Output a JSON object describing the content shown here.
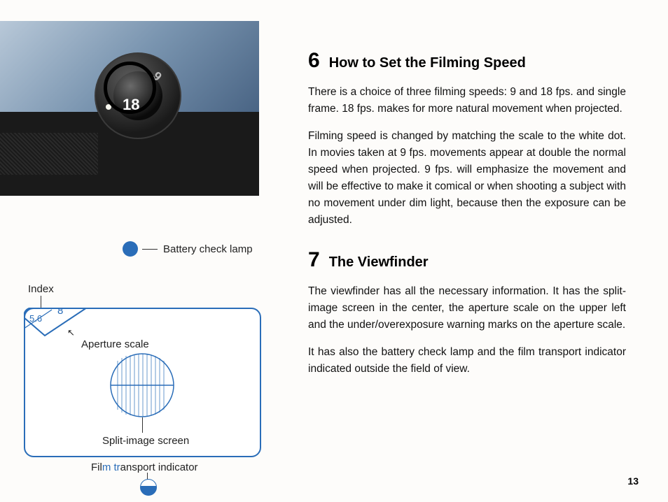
{
  "left": {
    "dial": {
      "num_18": "18",
      "num_9": "9"
    },
    "battery_check_label": "Battery check lamp",
    "index_label": "Index",
    "aperture": {
      "n56": "5.6",
      "n8": "8",
      "label": "Aperture scale"
    },
    "split_label": "Split-image screen",
    "film_label_pre": "Fil",
    "film_label_m": "m tr",
    "film_label_post": "ansport indicator"
  },
  "sections": [
    {
      "num": "6",
      "title": "How to Set the Filming Speed",
      "paras": [
        "There is a choice of three filming speeds: 9 and 18 fps. and single frame. 18 fps. makes for more natural movement when projected.",
        "Filming speed is changed by matching the scale to the white dot. In movies taken at 9 fps. movements appear at double the normal speed when projected. 9 fps. will emphasize the movement and will be effective to make it comical or when shooting a subject with no movement under dim light, because then the exposure can be adjusted."
      ]
    },
    {
      "num": "7",
      "title": "The Viewfinder",
      "paras": [
        "The viewfinder has all the necessary information. It has the split-image screen in the center, the aperture scale on the upper left and the under/overexposure warning marks on the aperture scale.",
        "It has also the battery check lamp and the film transport indicator indicated outside the field of view."
      ]
    }
  ],
  "page_number": "13"
}
